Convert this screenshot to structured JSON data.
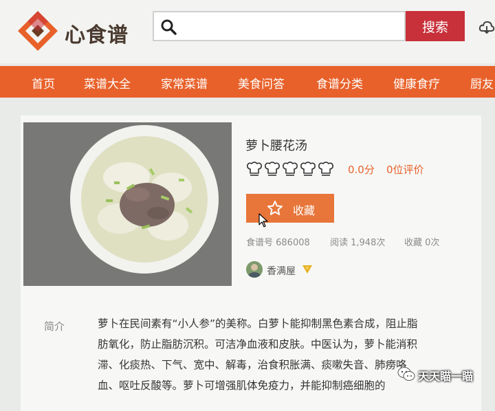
{
  "brand": {
    "name": "心食谱",
    "accent": "#e8612a",
    "search_button_color": "#c8303a"
  },
  "search": {
    "placeholder": "",
    "button_label": "搜索"
  },
  "nav": {
    "items": [
      {
        "label": "首页"
      },
      {
        "label": "菜谱大全"
      },
      {
        "label": "家常菜谱"
      },
      {
        "label": "美食问答"
      },
      {
        "label": "食谱分类"
      },
      {
        "label": "健康食疗"
      },
      {
        "label": "厨友"
      }
    ]
  },
  "recipe": {
    "title": "萝卜腰花汤",
    "rating_max": 5,
    "rating_value": 0,
    "score": "0.0分",
    "reviews": "0位评价",
    "favorite_label": "收藏",
    "meta": {
      "id": "食谱号 686008",
      "reads": "阅读 1,948次",
      "favorites": "收藏 0次"
    },
    "author": {
      "name": "香满屋"
    }
  },
  "intro": {
    "label": "简介",
    "lines": [
      "萝卜在民间素有“小人参”的美称。白萝卜能抑制黑色素合成，阻止脂",
      "肪氧化，防止脂肪沉积。可洁净血液和皮肤。中医认为，萝卜能消积",
      "滞、化痰热、下气、宽中、解毒，治食积胀满、痰嗽失音、肺痨咯",
      "血、呕吐反酸等。萝卜可增强肌体免疫力，并能抑制癌细胞的"
    ]
  },
  "watermark": {
    "text": "天天瞄一瞄"
  },
  "icons": {
    "search": "search-icon",
    "cloud": "cloud-icon",
    "star": "star-icon",
    "chef_hat": "chef-hat-icon",
    "verified": "verified-badge-icon",
    "wechat": "wechat-icon"
  }
}
